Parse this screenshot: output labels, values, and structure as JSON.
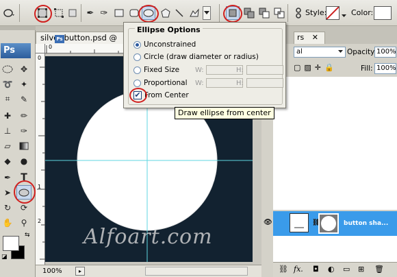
{
  "options_bar": {
    "style_label": "Style:",
    "color_label": "Color:",
    "color_swatch": "#ffffff",
    "style_swatch_slash": "#cc2020"
  },
  "tools_panel": {
    "logo_text": "Ps"
  },
  "document": {
    "tab_title": "silver button.psd @",
    "zoom": "100%",
    "ruler_top_labels": [
      "0",
      "1"
    ],
    "ruler_left_labels": [
      "0",
      "1",
      "2"
    ],
    "canvas_color": "#122230",
    "watermark": "Alfoart.com"
  },
  "ellipse_options": {
    "title": "Ellipse Options",
    "options": [
      {
        "label": "Unconstrained",
        "selected": true
      },
      {
        "label": "Circle (draw diameter or radius)",
        "selected": false
      },
      {
        "label": "Fixed Size",
        "selected": false
      },
      {
        "label": "Proportional",
        "selected": false
      }
    ],
    "w_label": "W:",
    "h_label": "H:",
    "from_center_label": "From Center",
    "from_center_checked": true
  },
  "tooltip": "Draw ellipse from center",
  "layers_panel": {
    "tab_fragment": "rs",
    "blend_mode_fragment": "al",
    "opacity_label": "Opacity:",
    "opacity_value": "100%",
    "fill_label": "Fill:",
    "fill_value": "100%",
    "layer_name": "button sha..."
  },
  "accent_color": "#3a9bea",
  "annotation_color": "#d0201f"
}
